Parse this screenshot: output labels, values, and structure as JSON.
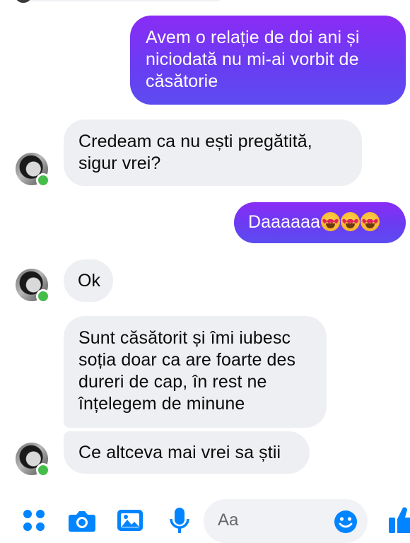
{
  "colors": {
    "accent": "#0084ff",
    "sent_gradient_top": "#8a2cf5",
    "sent_gradient_bottom": "#5c4cf0",
    "received_bubble": "#eeeff2",
    "presence_dot": "#45bd4a",
    "placeholder_text": "#65676b"
  },
  "messages": [
    {
      "direction": "sent",
      "lines": [
        "Avem o relație de doi ani și",
        "niciodată nu mi-ai vorbit de",
        "căsătorie"
      ]
    },
    {
      "direction": "received",
      "lines": [
        "Credeam ca nu ești pregătită,",
        "sigur vrei?"
      ]
    },
    {
      "direction": "sent",
      "text": "Daaaaaa",
      "emojis": [
        "heart-eyes-emoji",
        "heart-eyes-emoji",
        "heart-eyes-emoji"
      ]
    },
    {
      "direction": "received",
      "text": "Ok"
    },
    {
      "direction": "received",
      "lines": [
        "Sunt căsătorit și îmi iubesc",
        "soția doar ca are foarte des",
        "dureri de cap, în rest ne",
        "înțelegem de minune"
      ]
    },
    {
      "direction": "received",
      "text": "Ce altceva mai vrei sa știi"
    }
  ],
  "composer": {
    "placeholder": "Aa",
    "icons": [
      "menu-dots-icon",
      "camera-icon",
      "gallery-icon",
      "microphone-icon",
      "emoji-icon",
      "thumbs-up-icon"
    ]
  }
}
